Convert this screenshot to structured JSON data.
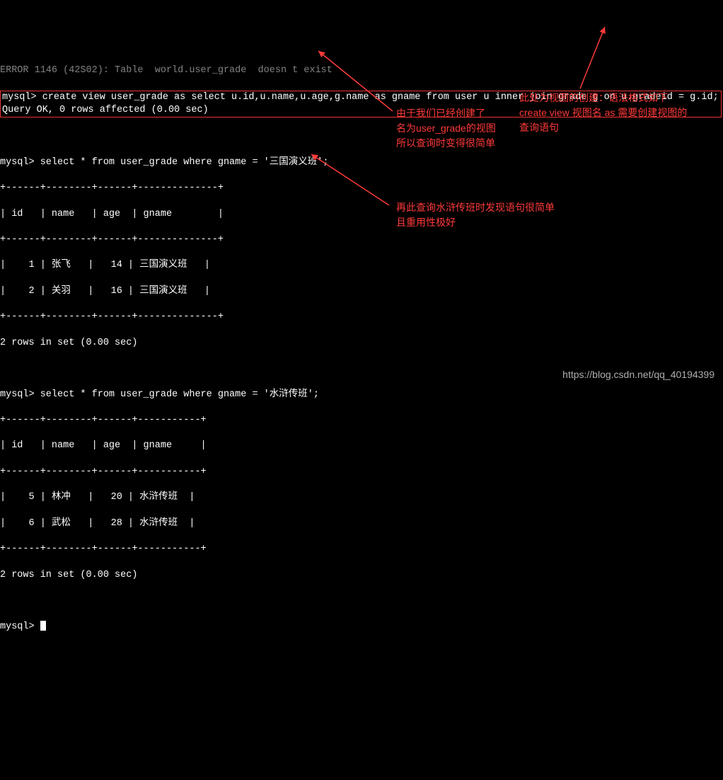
{
  "terminal": {
    "error_line": "ERROR 1146 (42S02): Table  world.user_grade  doesn t exist",
    "create_view_prompt": "mysql>",
    "create_view_cmd": " create view user_grade as select u.id,u.name,u.age,g.name as gname from user u inner join grade g on u.gradeid = g.id;",
    "create_view_result": "Query OK, 0 rows affected (0.00 sec)",
    "query1_prompt": "mysql>",
    "query1_cmd": " select * from user_grade where gname = '三国演义班';",
    "sep1": "+------+--------+------+--------------+",
    "header1": "| id   | name   | age  | gname        |",
    "row1a": "|    1 | 张飞   |   14 | 三国演义班   |",
    "row1b": "|    2 | 关羽   |   16 | 三国演义班   |",
    "result1": "2 rows in set (0.00 sec)",
    "query2_prompt": "mysql>",
    "query2_cmd": " select * from user_grade where gname = '水浒传班';",
    "sep2": "+------+--------+------+-----------+",
    "header2": "| id   | name   | age  | gname     |",
    "row2a": "|    5 | 林冲   |   20 | 水浒传班  |",
    "row2b": "|    6 | 武松   |   28 | 水浒传班  |",
    "result2": "2 rows in set (0.00 sec)",
    "final_prompt": "mysql> "
  },
  "annotations": {
    "a1_l1": "由于我们已经创建了",
    "a1_l2": "名为user_grade的视图",
    "a1_l3": "所以查询时变得很简单",
    "a2_l1": "此处为视图的创建：语法格式如下",
    "a2_l2": "create view 视图名 as 需要创建视图的",
    "a2_l3": "查询语句",
    "a3_l1": "再此查询水浒传班时发现语句很简单",
    "a3_l2": "且重用性极好"
  },
  "watermark": "https://blog.csdn.net/qq_40194399"
}
